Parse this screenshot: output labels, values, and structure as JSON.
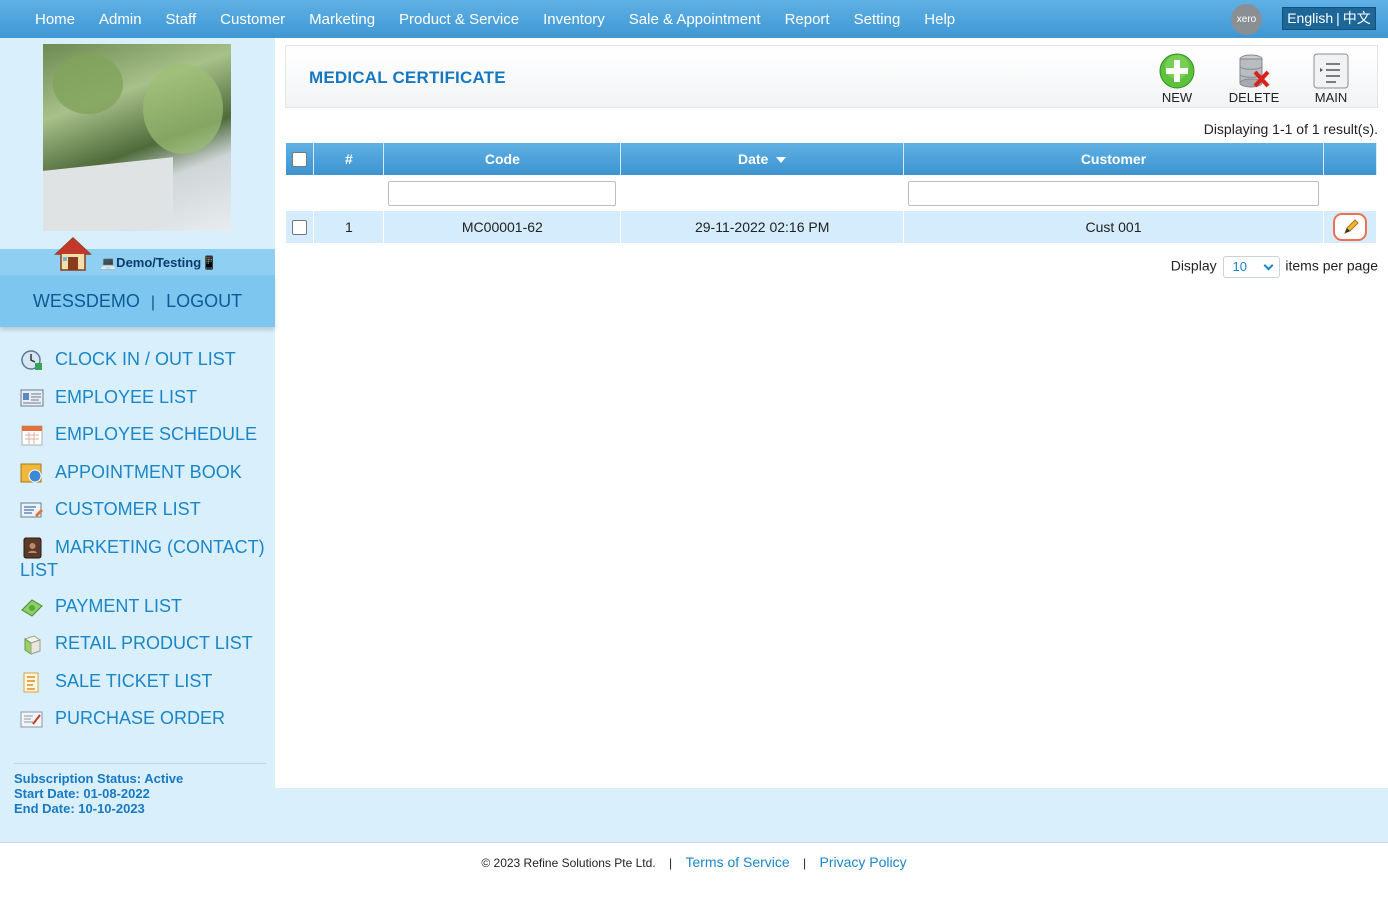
{
  "topnav": {
    "items": [
      "Home",
      "Admin",
      "Staff",
      "Customer",
      "Marketing",
      "Product & Service",
      "Inventory",
      "Sale & Appointment",
      "Report",
      "Setting",
      "Help"
    ],
    "xero_label": "xero",
    "lang_en": "English",
    "lang_sep": "|",
    "lang_zh": "中文"
  },
  "sidebar": {
    "company": "💻Demo/Testing📱",
    "username": "WESSDEMO",
    "separator": "|",
    "logout": "LOGOUT",
    "menu": [
      {
        "label": "CLOCK IN / OUT LIST",
        "icon": "clock-icon"
      },
      {
        "label": "EMPLOYEE LIST",
        "icon": "employee-card-icon"
      },
      {
        "label": "EMPLOYEE SCHEDULE",
        "icon": "calendar-icon"
      },
      {
        "label": "APPOINTMENT BOOK",
        "icon": "book-icon"
      },
      {
        "label": "CUSTOMER LIST",
        "icon": "customer-card-icon"
      },
      {
        "label": "MARKETING (CONTACT) LIST",
        "icon": "contact-book-icon"
      },
      {
        "label": "PAYMENT LIST",
        "icon": "money-icon"
      },
      {
        "label": "RETAIL PRODUCT LIST",
        "icon": "product-box-icon"
      },
      {
        "label": "SALE TICKET LIST",
        "icon": "ticket-icon"
      },
      {
        "label": "PURCHASE ORDER",
        "icon": "purchase-order-icon"
      }
    ],
    "subscription_status": "Subscription Status: Active",
    "start_date": "Start Date: 01-08-2022",
    "end_date": "End Date: 10-10-2023"
  },
  "page": {
    "title": "MEDICAL CERTIFICATE",
    "buttons": {
      "new": "NEW",
      "delete": "DELETE",
      "main": "MAIN"
    },
    "displaying": "Displaying 1-1 of 1 result(s).",
    "columns": {
      "num": "#",
      "code": "Code",
      "date": "Date",
      "customer": "Customer"
    },
    "rows": [
      {
        "num": "1",
        "code": "MC00001-62",
        "date": "29-11-2022 02:16 PM",
        "customer": "Cust 001"
      }
    ],
    "pager": {
      "display": "Display",
      "per_page_value": "10",
      "suffix": "items per page"
    }
  },
  "footer": {
    "copyright": "© 2023 Refine Solutions Pte Ltd.",
    "sep": "|",
    "terms": "Terms of Service",
    "privacy": "Privacy Policy"
  },
  "colors": {
    "nav_blue": "#4aa3dc",
    "sidebar_bg": "#d9effb",
    "link_blue": "#1a86c8",
    "title_blue": "#1778c2",
    "row_bg": "#d4ecfc"
  }
}
